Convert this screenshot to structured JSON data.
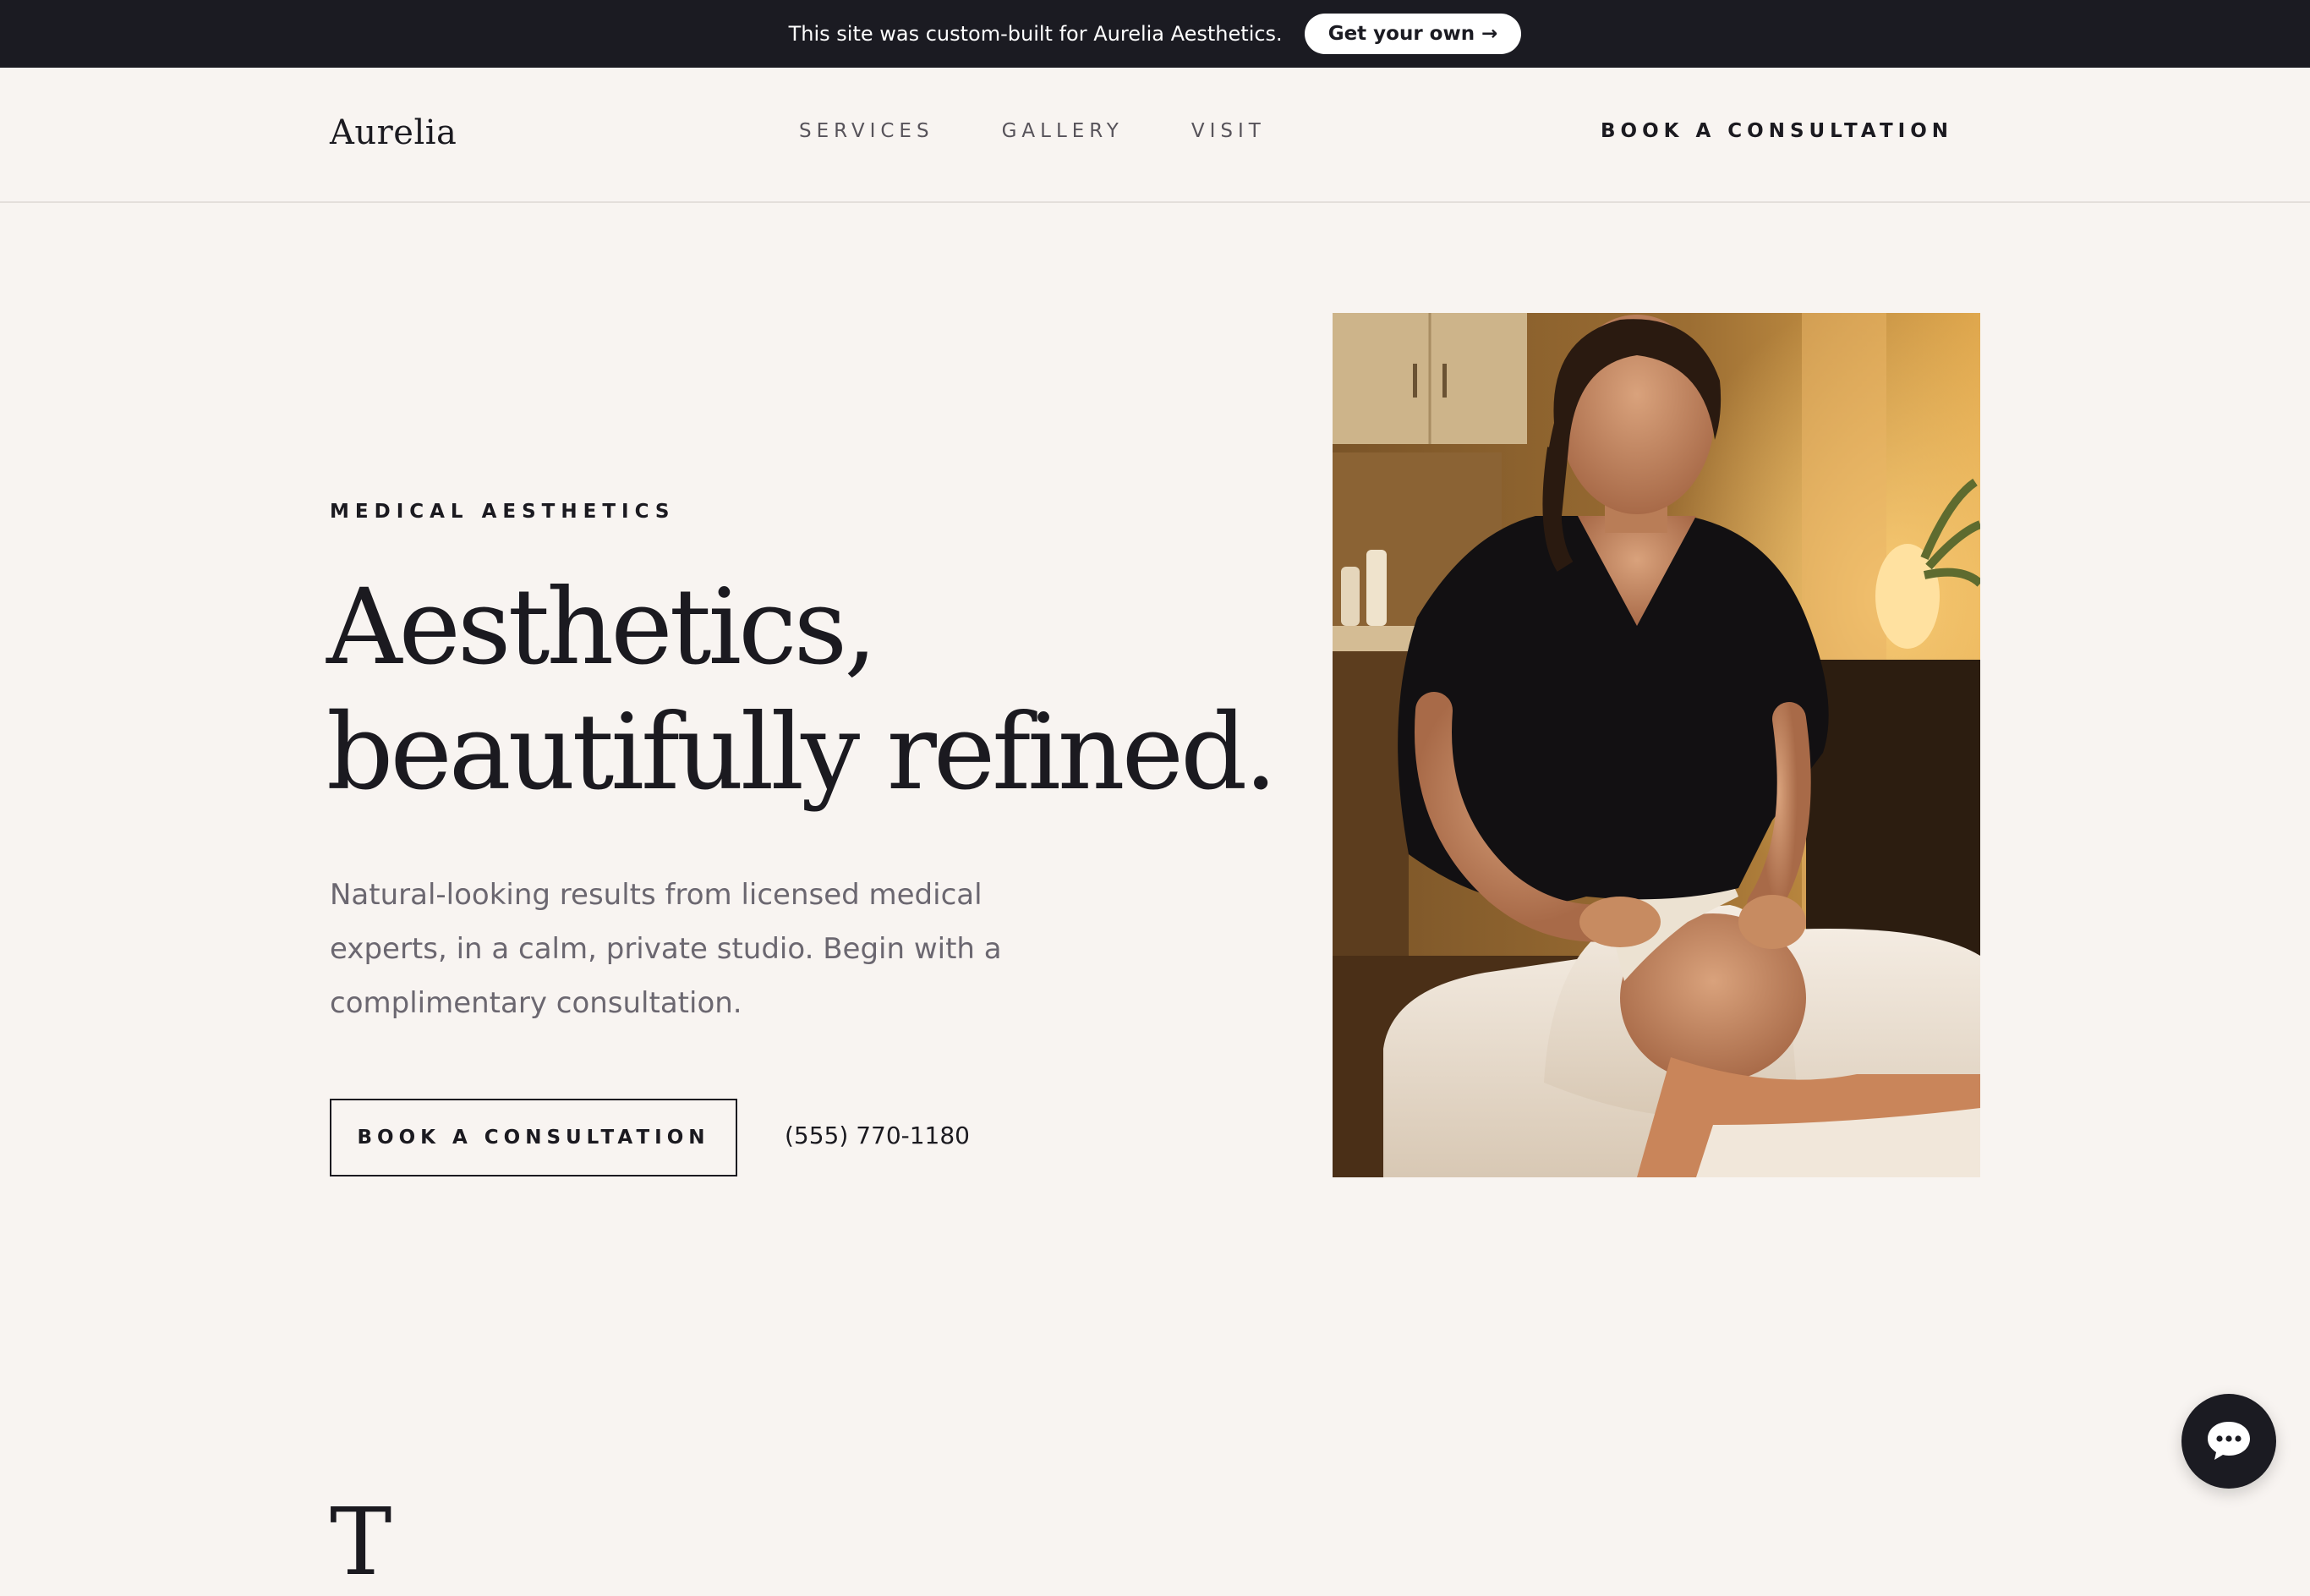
{
  "banner": {
    "text": "This site was custom-built for Aurelia Aesthetics.",
    "button_label": "Get your own →"
  },
  "nav": {
    "logo": "Aurelia",
    "links": [
      {
        "label": "SERVICES"
      },
      {
        "label": "GALLERY"
      },
      {
        "label": "VISIT"
      }
    ],
    "cta_label": "BOOK A CONSULTATION"
  },
  "hero": {
    "eyebrow": "MEDICAL AESTHETICS",
    "headline_line1": "Aesthetics,",
    "headline_line2": "beautifully refined.",
    "lead": "Natural-looking results from licensed medical experts, in a calm, private studio. Begin with a complimentary consultation.",
    "cta_label": "BOOK A CONSULTATION",
    "phone": "(555) 770-1180",
    "image_alt": "Aesthetician performing a facial treatment on a client in a warmly lit studio"
  },
  "next_section": {
    "heading_peek": "T"
  },
  "chat": {
    "icon": "chat-bubble-icon"
  },
  "colors": {
    "background": "#f8f4f1",
    "ink": "#1b1a20",
    "muted": "#6b6770",
    "banner": "#1b1b22"
  }
}
